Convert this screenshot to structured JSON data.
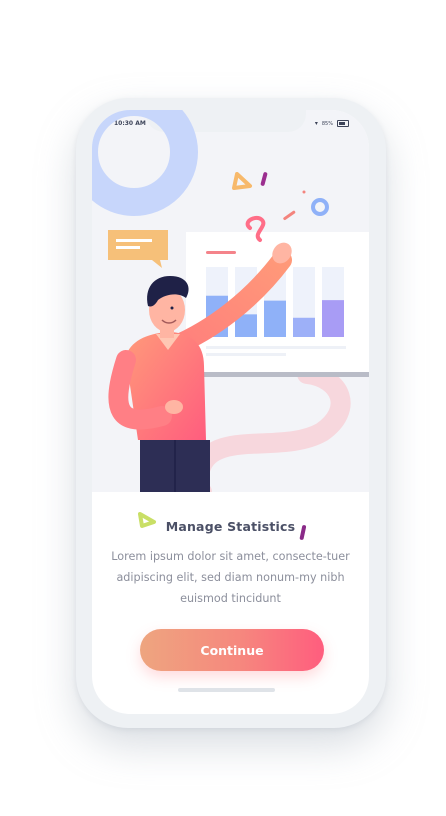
{
  "status_bar": {
    "time": "10:30 AM",
    "battery": "85%"
  },
  "onboarding": {
    "title": "Manage Statistics",
    "description": "Lorem ipsum dolor sit amet, consecte-tuer adipiscing elit, sed diam nonum-my nibh euismod tincidunt",
    "button_label": "Continue"
  },
  "illustration": {
    "bar_levels": [
      0.72,
      0.34,
      0.62,
      0.27,
      0.63
    ],
    "bar_colors": [
      "#8fb1f8",
      "#8fb1f8",
      "#8fb1f8",
      "#9db0f8",
      "#a89cf5"
    ]
  },
  "colors": {
    "accent_start": "#eea57f",
    "accent_end": "#ff5d7e",
    "title": "#4b5066",
    "text": "#8c8f9c"
  }
}
